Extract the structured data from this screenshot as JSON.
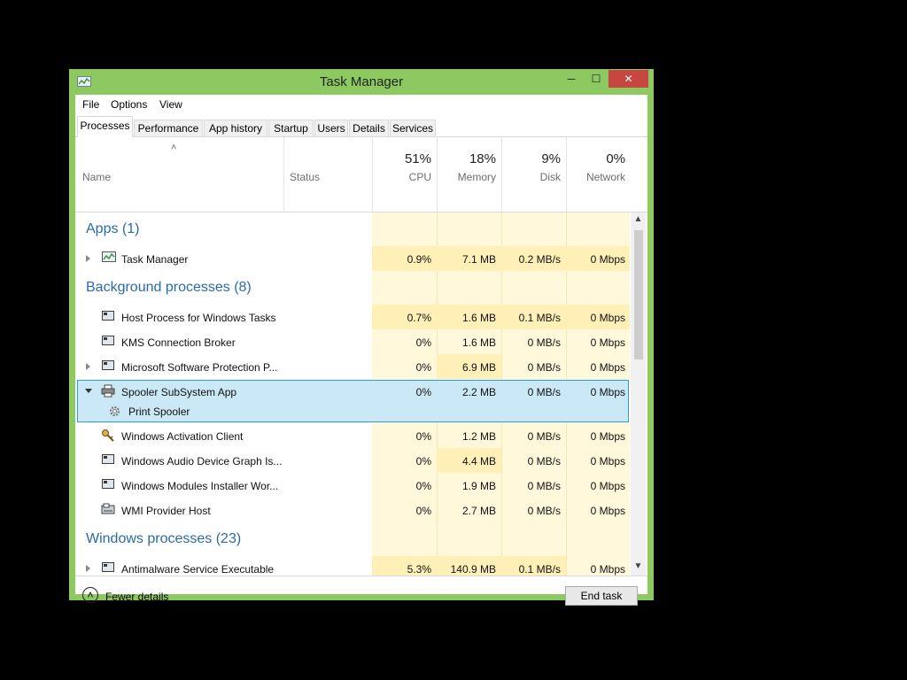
{
  "window": {
    "title": "Task Manager",
    "minimize": "─",
    "maximize": "☐",
    "close": "✕"
  },
  "menu": [
    "File",
    "Options",
    "View"
  ],
  "tabs": [
    "Processes",
    "Performance",
    "App history",
    "Startup",
    "Users",
    "Details",
    "Services"
  ],
  "header": {
    "sort_arrow": "˄",
    "name": "Name",
    "status": "Status",
    "cpu_pct": "51%",
    "cpu": "CPU",
    "mem_pct": "18%",
    "mem": "Memory",
    "disk_pct": "9%",
    "disk": "Disk",
    "net_pct": "0%",
    "net": "Network"
  },
  "groups": {
    "apps": "Apps (1)",
    "background": "Background processes (8)",
    "windows": "Windows processes (23)"
  },
  "rows": [
    {
      "name": "Task Manager",
      "cpu": "0.9%",
      "mem": "7.1 MB",
      "disk": "0.2 MB/s",
      "net": "0 Mbps"
    },
    {
      "name": "Host Process for Windows Tasks",
      "cpu": "0.7%",
      "mem": "1.6 MB",
      "disk": "0.1 MB/s",
      "net": "0 Mbps"
    },
    {
      "name": "KMS Connection Broker",
      "cpu": "0%",
      "mem": "1.6 MB",
      "disk": "0 MB/s",
      "net": "0 Mbps"
    },
    {
      "name": "Microsoft Software Protection P...",
      "cpu": "0%",
      "mem": "6.9 MB",
      "disk": "0 MB/s",
      "net": "0 Mbps"
    },
    {
      "name": "Spooler SubSystem App",
      "cpu": "0%",
      "mem": "2.2 MB",
      "disk": "0 MB/s",
      "net": "0 Mbps"
    },
    {
      "name": "Print Spooler"
    },
    {
      "name": "Windows Activation Client",
      "cpu": "0%",
      "mem": "1.2 MB",
      "disk": "0 MB/s",
      "net": "0 Mbps"
    },
    {
      "name": "Windows Audio Device Graph Is...",
      "cpu": "0%",
      "mem": "4.4 MB",
      "disk": "0 MB/s",
      "net": "0 Mbps"
    },
    {
      "name": "Windows Modules Installer Wor...",
      "cpu": "0%",
      "mem": "1.9 MB",
      "disk": "0 MB/s",
      "net": "0 Mbps"
    },
    {
      "name": "WMI Provider Host",
      "cpu": "0%",
      "mem": "2.7 MB",
      "disk": "0 MB/s",
      "net": "0 Mbps"
    },
    {
      "name": "Antimalware Service Executable",
      "cpu": "5.3%",
      "mem": "140.9 MB",
      "disk": "0.1 MB/s",
      "net": "0 Mbps"
    }
  ],
  "scroll": {
    "up": "▲",
    "down": "▼"
  },
  "footer": {
    "fewer_details": "Fewer details",
    "fewer_icon": "˄",
    "end_task": "End task"
  },
  "colors": {
    "frame": "#8cc960",
    "heat_light": "#fff8db",
    "heat_medium": "#fff0b8",
    "selection": "#cbe8f6",
    "group_text": "#2a6aaa"
  }
}
